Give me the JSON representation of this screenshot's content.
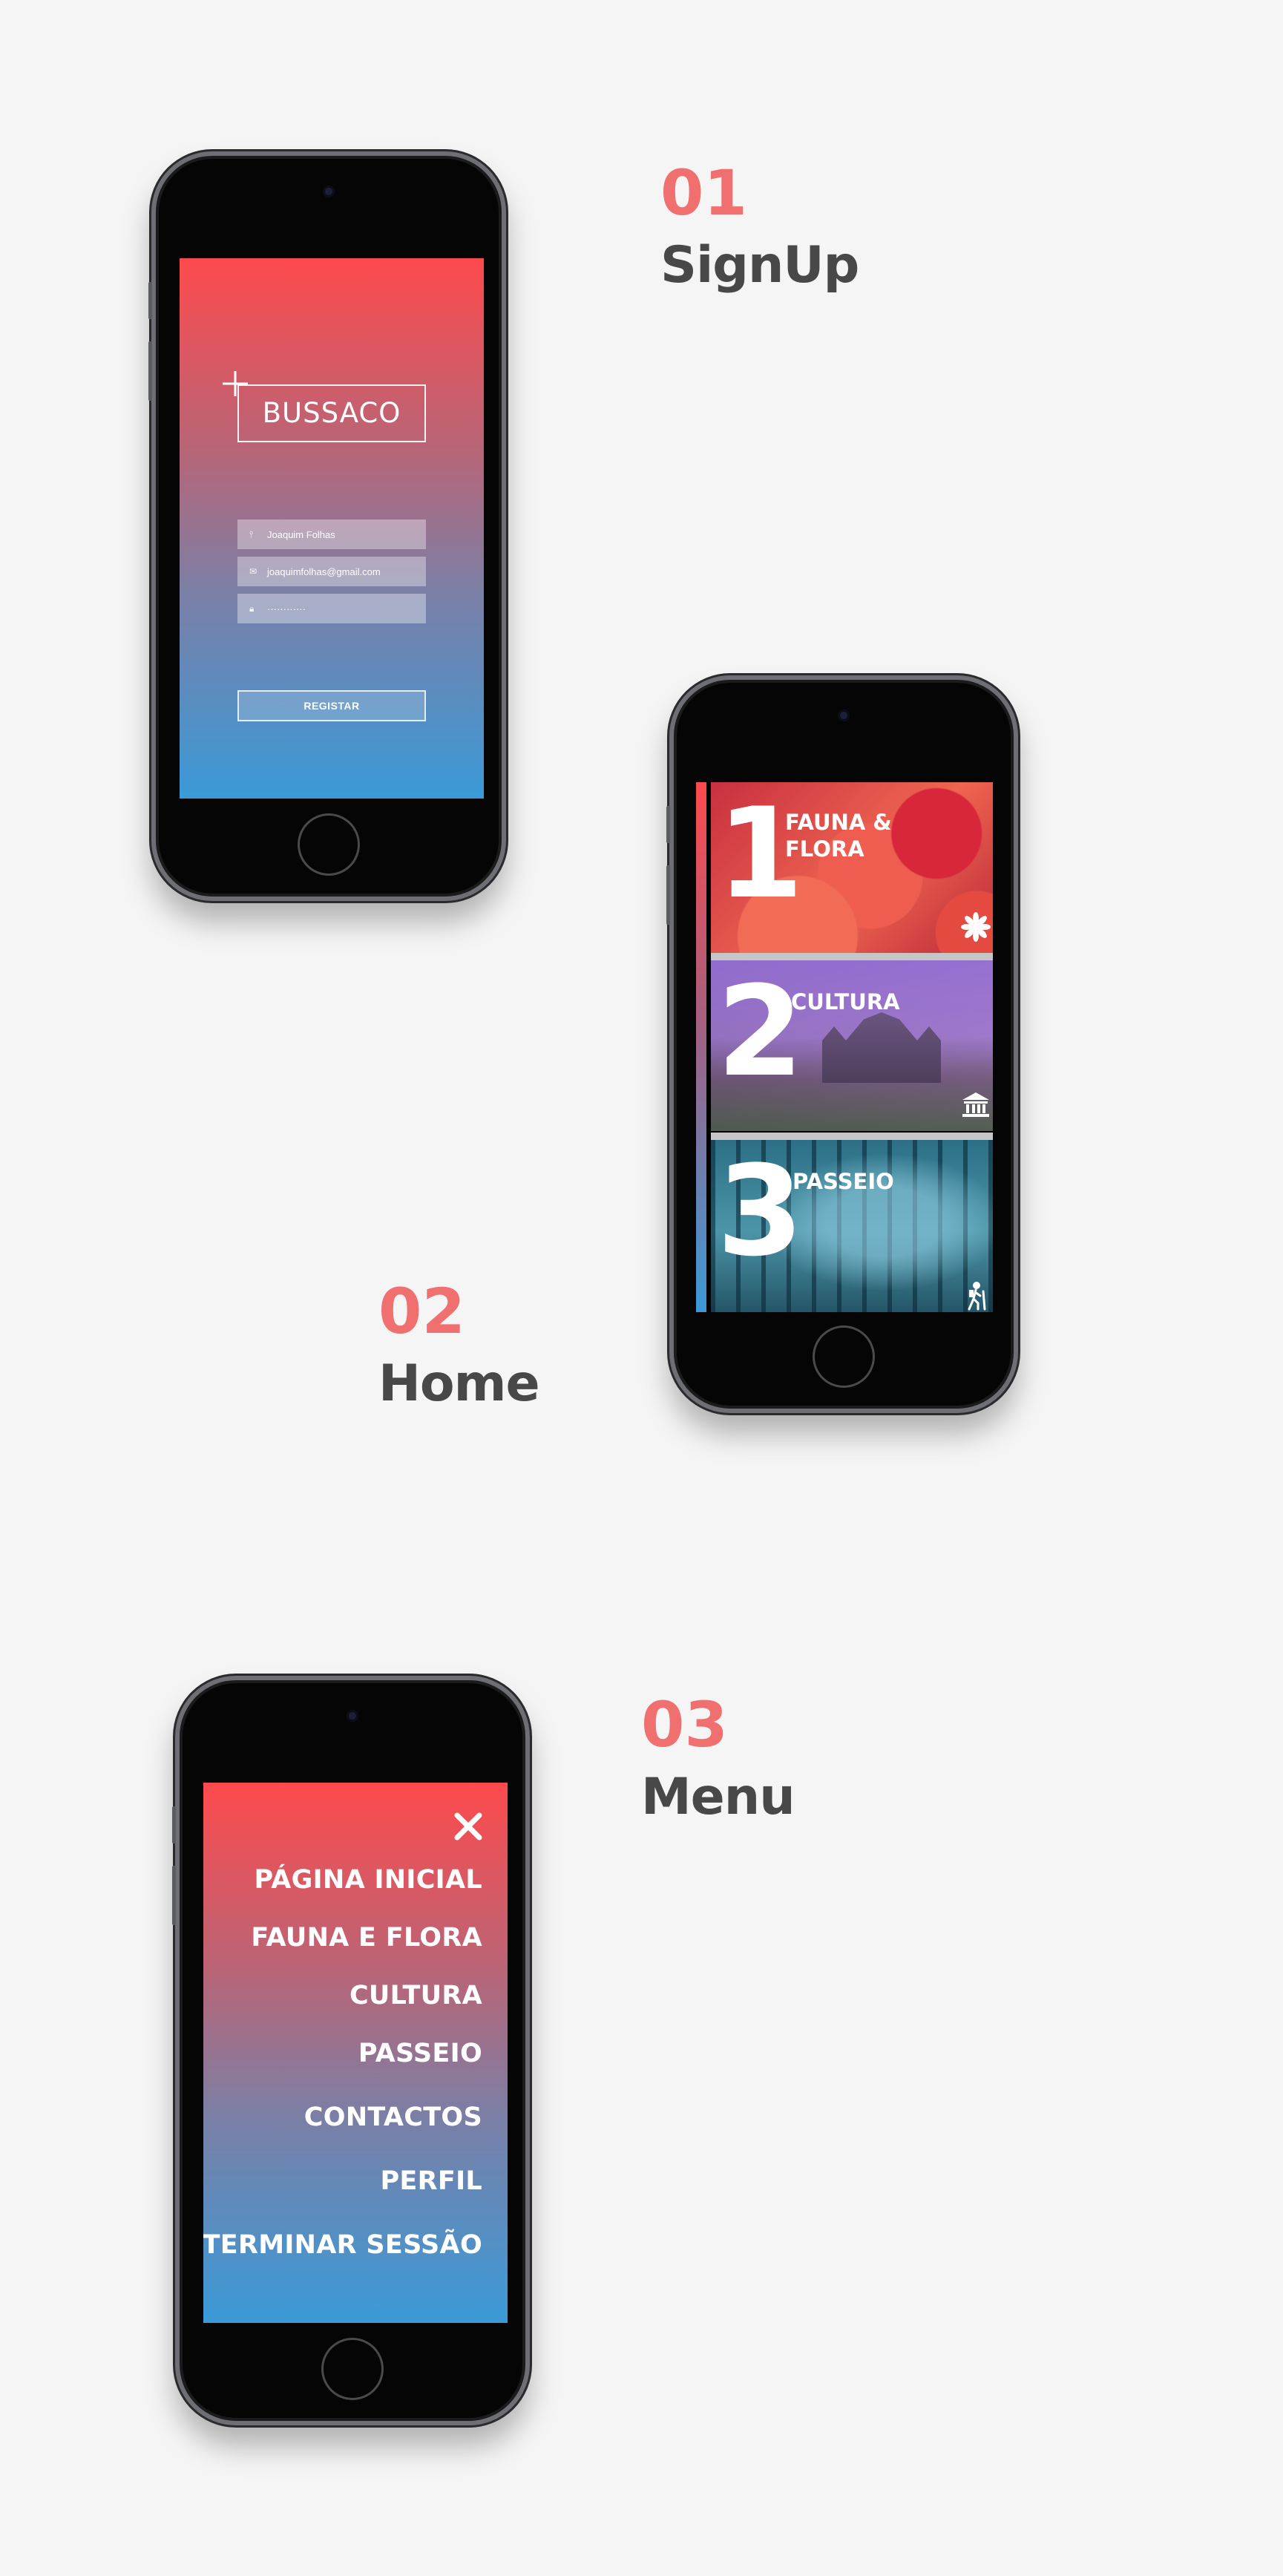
{
  "sections": {
    "signup": {
      "number": "01",
      "title": "SignUp"
    },
    "home": {
      "number": "02",
      "title": "Home"
    },
    "menu": {
      "number": "03",
      "title": "Menu"
    }
  },
  "signup_screen": {
    "logo": "BUSSACO",
    "fields": [
      {
        "icon": "user-icon",
        "value": "Joaquim Folhas"
      },
      {
        "icon": "mail-icon",
        "value": "joaquimfolhas@gmail.com"
      },
      {
        "icon": "lock-icon",
        "value": "············"
      }
    ],
    "register_label": "REGISTAR"
  },
  "home_screen": {
    "cards": [
      {
        "number": "1",
        "title": "FAUNA & FLORA",
        "icon": "flower-icon"
      },
      {
        "number": "2",
        "title": "CULTURA",
        "icon": "museum-icon"
      },
      {
        "number": "3",
        "title": "PASSEIO",
        "icon": "hiker-icon"
      }
    ]
  },
  "menu_screen": {
    "items": [
      "PÁGINA INICIAL",
      "FAUNA E FLORA",
      "CULTURA",
      "PASSEIO",
      "CONTACTOS",
      "PERFIL",
      "TERMINAR SESSÃO"
    ]
  },
  "colors": {
    "accent": "#f07070",
    "heading": "#484848",
    "gradient_top": "#fd4a4c",
    "gradient_bottom": "#3a9ad8"
  }
}
